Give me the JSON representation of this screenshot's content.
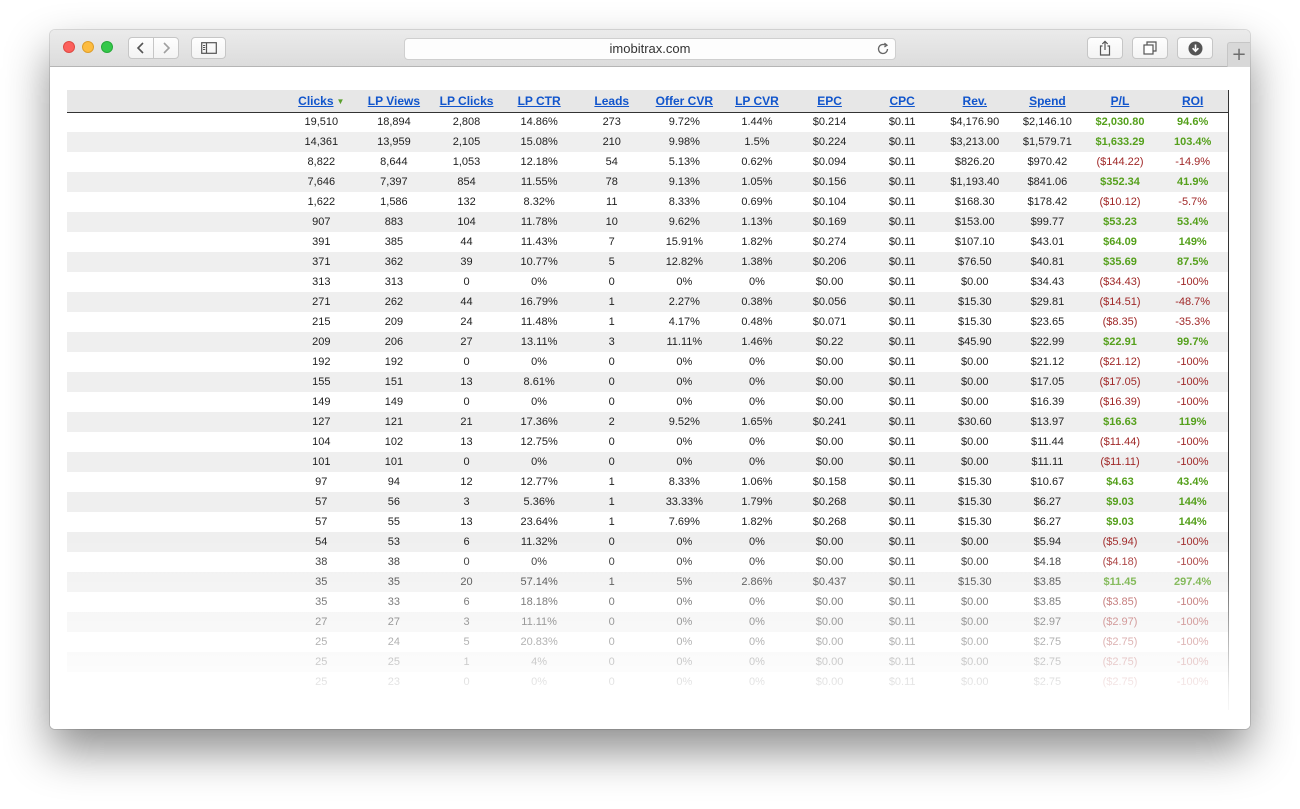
{
  "browser": {
    "url": "imobitrax.com"
  },
  "table": {
    "headers": [
      "",
      "Clicks",
      "LP Views",
      "LP Clicks",
      "LP CTR",
      "Leads",
      "Offer CVR",
      "LP CVR",
      "EPC",
      "CPC",
      "Rev.",
      "Spend",
      "P/L",
      "ROI"
    ],
    "sort_indicator": "▼",
    "rows": [
      [
        "",
        "19,510",
        "18,894",
        "2,808",
        "14.86%",
        "273",
        "9.72%",
        "1.44%",
        "$0.214",
        "$0.11",
        "$4,176.90",
        "$2,146.10",
        "$2,030.80",
        "94.6%"
      ],
      [
        "",
        "14,361",
        "13,959",
        "2,105",
        "15.08%",
        "210",
        "9.98%",
        "1.5%",
        "$0.224",
        "$0.11",
        "$3,213.00",
        "$1,579.71",
        "$1,633.29",
        "103.4%"
      ],
      [
        "",
        "8,822",
        "8,644",
        "1,053",
        "12.18%",
        "54",
        "5.13%",
        "0.62%",
        "$0.094",
        "$0.11",
        "$826.20",
        "$970.42",
        "($144.22)",
        "-14.9%"
      ],
      [
        "",
        "7,646",
        "7,397",
        "854",
        "11.55%",
        "78",
        "9.13%",
        "1.05%",
        "$0.156",
        "$0.11",
        "$1,193.40",
        "$841.06",
        "$352.34",
        "41.9%"
      ],
      [
        "",
        "1,622",
        "1,586",
        "132",
        "8.32%",
        "11",
        "8.33%",
        "0.69%",
        "$0.104",
        "$0.11",
        "$168.30",
        "$178.42",
        "($10.12)",
        "-5.7%"
      ],
      [
        "",
        "907",
        "883",
        "104",
        "11.78%",
        "10",
        "9.62%",
        "1.13%",
        "$0.169",
        "$0.11",
        "$153.00",
        "$99.77",
        "$53.23",
        "53.4%"
      ],
      [
        "",
        "391",
        "385",
        "44",
        "11.43%",
        "7",
        "15.91%",
        "1.82%",
        "$0.274",
        "$0.11",
        "$107.10",
        "$43.01",
        "$64.09",
        "149%"
      ],
      [
        "",
        "371",
        "362",
        "39",
        "10.77%",
        "5",
        "12.82%",
        "1.38%",
        "$0.206",
        "$0.11",
        "$76.50",
        "$40.81",
        "$35.69",
        "87.5%"
      ],
      [
        "",
        "313",
        "313",
        "0",
        "0%",
        "0",
        "0%",
        "0%",
        "$0.00",
        "$0.11",
        "$0.00",
        "$34.43",
        "($34.43)",
        "-100%"
      ],
      [
        "",
        "271",
        "262",
        "44",
        "16.79%",
        "1",
        "2.27%",
        "0.38%",
        "$0.056",
        "$0.11",
        "$15.30",
        "$29.81",
        "($14.51)",
        "-48.7%"
      ],
      [
        "",
        "215",
        "209",
        "24",
        "11.48%",
        "1",
        "4.17%",
        "0.48%",
        "$0.071",
        "$0.11",
        "$15.30",
        "$23.65",
        "($8.35)",
        "-35.3%"
      ],
      [
        "",
        "209",
        "206",
        "27",
        "13.11%",
        "3",
        "11.11%",
        "1.46%",
        "$0.22",
        "$0.11",
        "$45.90",
        "$22.99",
        "$22.91",
        "99.7%"
      ],
      [
        "",
        "192",
        "192",
        "0",
        "0%",
        "0",
        "0%",
        "0%",
        "$0.00",
        "$0.11",
        "$0.00",
        "$21.12",
        "($21.12)",
        "-100%"
      ],
      [
        "",
        "155",
        "151",
        "13",
        "8.61%",
        "0",
        "0%",
        "0%",
        "$0.00",
        "$0.11",
        "$0.00",
        "$17.05",
        "($17.05)",
        "-100%"
      ],
      [
        "",
        "149",
        "149",
        "0",
        "0%",
        "0",
        "0%",
        "0%",
        "$0.00",
        "$0.11",
        "$0.00",
        "$16.39",
        "($16.39)",
        "-100%"
      ],
      [
        "",
        "127",
        "121",
        "21",
        "17.36%",
        "2",
        "9.52%",
        "1.65%",
        "$0.241",
        "$0.11",
        "$30.60",
        "$13.97",
        "$16.63",
        "119%"
      ],
      [
        "",
        "104",
        "102",
        "13",
        "12.75%",
        "0",
        "0%",
        "0%",
        "$0.00",
        "$0.11",
        "$0.00",
        "$11.44",
        "($11.44)",
        "-100%"
      ],
      [
        "",
        "101",
        "101",
        "0",
        "0%",
        "0",
        "0%",
        "0%",
        "$0.00",
        "$0.11",
        "$0.00",
        "$11.11",
        "($11.11)",
        "-100%"
      ],
      [
        "",
        "97",
        "94",
        "12",
        "12.77%",
        "1",
        "8.33%",
        "1.06%",
        "$0.158",
        "$0.11",
        "$15.30",
        "$10.67",
        "$4.63",
        "43.4%"
      ],
      [
        "",
        "57",
        "56",
        "3",
        "5.36%",
        "1",
        "33.33%",
        "1.79%",
        "$0.268",
        "$0.11",
        "$15.30",
        "$6.27",
        "$9.03",
        "144%"
      ],
      [
        "",
        "57",
        "55",
        "13",
        "23.64%",
        "1",
        "7.69%",
        "1.82%",
        "$0.268",
        "$0.11",
        "$15.30",
        "$6.27",
        "$9.03",
        "144%"
      ],
      [
        "",
        "54",
        "53",
        "6",
        "11.32%",
        "0",
        "0%",
        "0%",
        "$0.00",
        "$0.11",
        "$0.00",
        "$5.94",
        "($5.94)",
        "-100%"
      ],
      [
        "",
        "38",
        "38",
        "0",
        "0%",
        "0",
        "0%",
        "0%",
        "$0.00",
        "$0.11",
        "$0.00",
        "$4.18",
        "($4.18)",
        "-100%"
      ],
      [
        "",
        "35",
        "35",
        "20",
        "57.14%",
        "1",
        "5%",
        "2.86%",
        "$0.437",
        "$0.11",
        "$15.30",
        "$3.85",
        "$11.45",
        "297.4%"
      ],
      [
        "",
        "35",
        "33",
        "6",
        "18.18%",
        "0",
        "0%",
        "0%",
        "$0.00",
        "$0.11",
        "$0.00",
        "$3.85",
        "($3.85)",
        "-100%"
      ],
      [
        "",
        "27",
        "27",
        "3",
        "11.11%",
        "0",
        "0%",
        "0%",
        "$0.00",
        "$0.11",
        "$0.00",
        "$2.97",
        "($2.97)",
        "-100%"
      ],
      [
        "",
        "25",
        "24",
        "5",
        "20.83%",
        "0",
        "0%",
        "0%",
        "$0.00",
        "$0.11",
        "$0.00",
        "$2.75",
        "($2.75)",
        "-100%"
      ],
      [
        "",
        "25",
        "25",
        "1",
        "4%",
        "0",
        "0%",
        "0%",
        "$0.00",
        "$0.11",
        "$0.00",
        "$2.75",
        "($2.75)",
        "-100%"
      ],
      [
        "",
        "25",
        "23",
        "0",
        "0%",
        "0",
        "0%",
        "0%",
        "$0.00",
        "$0.11",
        "$0.00",
        "$2.75",
        "($2.75)",
        "-100%"
      ]
    ]
  }
}
